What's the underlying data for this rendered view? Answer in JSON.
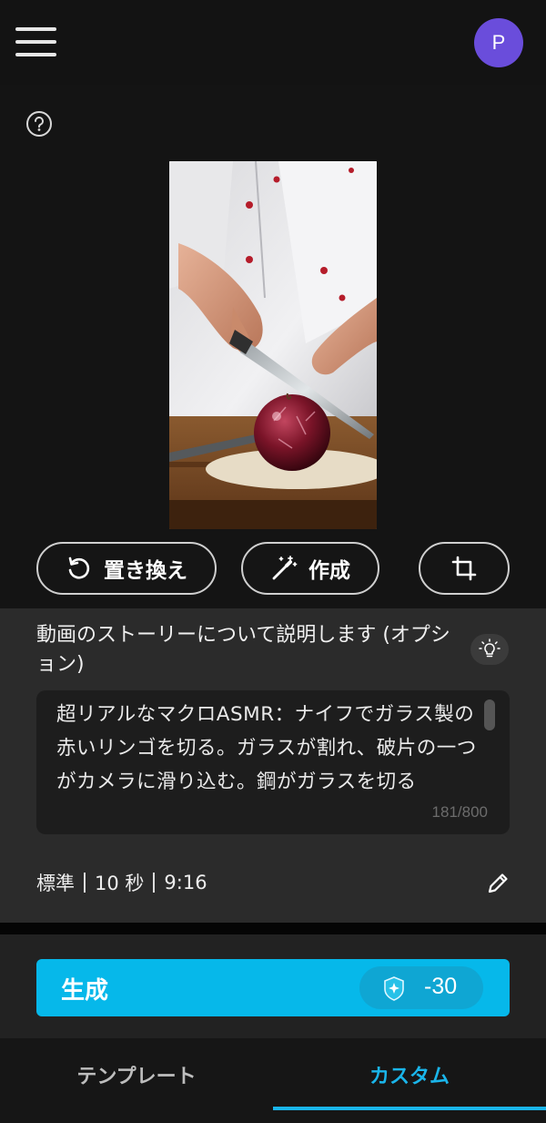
{
  "header": {
    "menu_icon": "hamburger-icon",
    "avatar_initial": "P",
    "avatar_color": "#6a4ddb"
  },
  "help_icon": "question-circle-icon",
  "actions": {
    "replace_label": "置き換え",
    "replace_icon": "rotate-ccw-icon",
    "create_label": "作成",
    "create_icon": "magic-wand-icon",
    "crop_icon": "crop-icon"
  },
  "story": {
    "label": "動画のストーリーについて説明します (オプション)",
    "bulb_icon": "lightbulb-icon",
    "prompt": "超リアルなマクロASMR：ナイフでガラス製の赤いリンゴを切る。ガラスが割れ、破片の一つがカメラに滑り込む。鋼がガラスを切る",
    "counter": "181/800"
  },
  "settings": {
    "quality": "標準",
    "duration": "10 秒",
    "ratio": "9:16",
    "edit_icon": "pencil-icon"
  },
  "generate": {
    "label": "生成",
    "credit_icon": "sparkle-badge-icon",
    "credit_value": "-30",
    "accent": "#06b8ea"
  },
  "tabs": {
    "templates": "テンプレート",
    "custom": "カスタム",
    "active": "custom",
    "active_color": "#1ab5ea"
  }
}
